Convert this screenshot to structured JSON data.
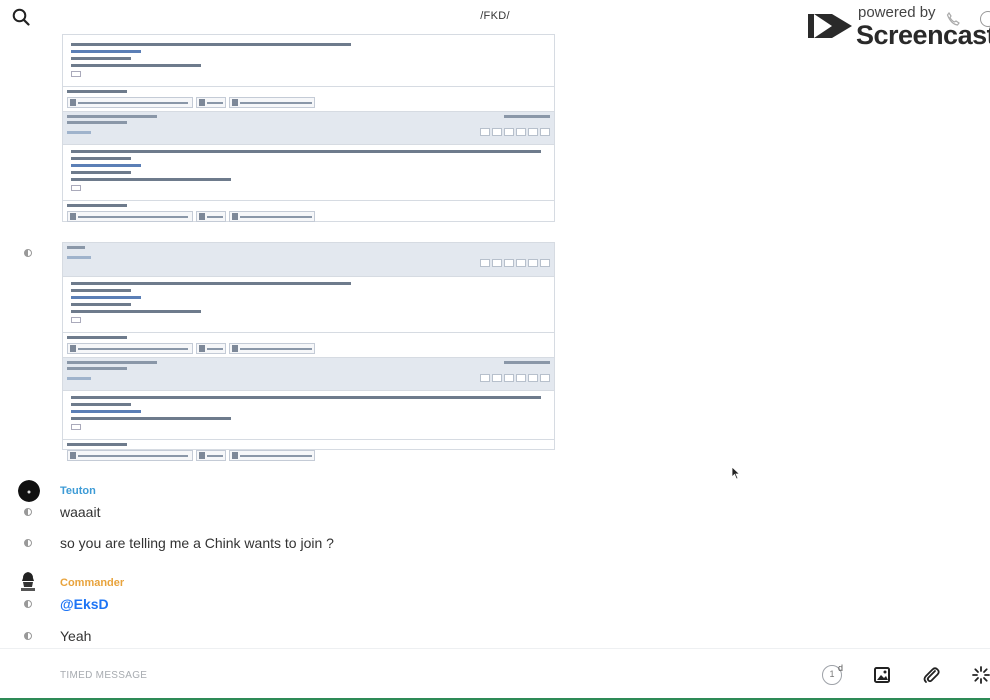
{
  "header": {
    "title": "/FKD/",
    "watermark_powered": "powered by",
    "watermark_brand": "Screencastify"
  },
  "messages": [
    {
      "author": "Teuton",
      "author_color": "#3d9bd6",
      "lines": [
        "waaait",
        "so you are telling me a Chink wants to join ?"
      ]
    },
    {
      "author": "Commander",
      "author_color": "#e8a33c",
      "lines": [
        "@EksD",
        "Yeah"
      ]
    }
  ],
  "composer": {
    "placeholder": "TIMED MESSAGE",
    "timer_value": "1",
    "timer_unit": "d"
  },
  "icons": [
    "search-icon",
    "phone-icon",
    "info-icon",
    "timer-icon",
    "image-icon",
    "attachment-icon",
    "loading-icon",
    "cursor-icon"
  ]
}
